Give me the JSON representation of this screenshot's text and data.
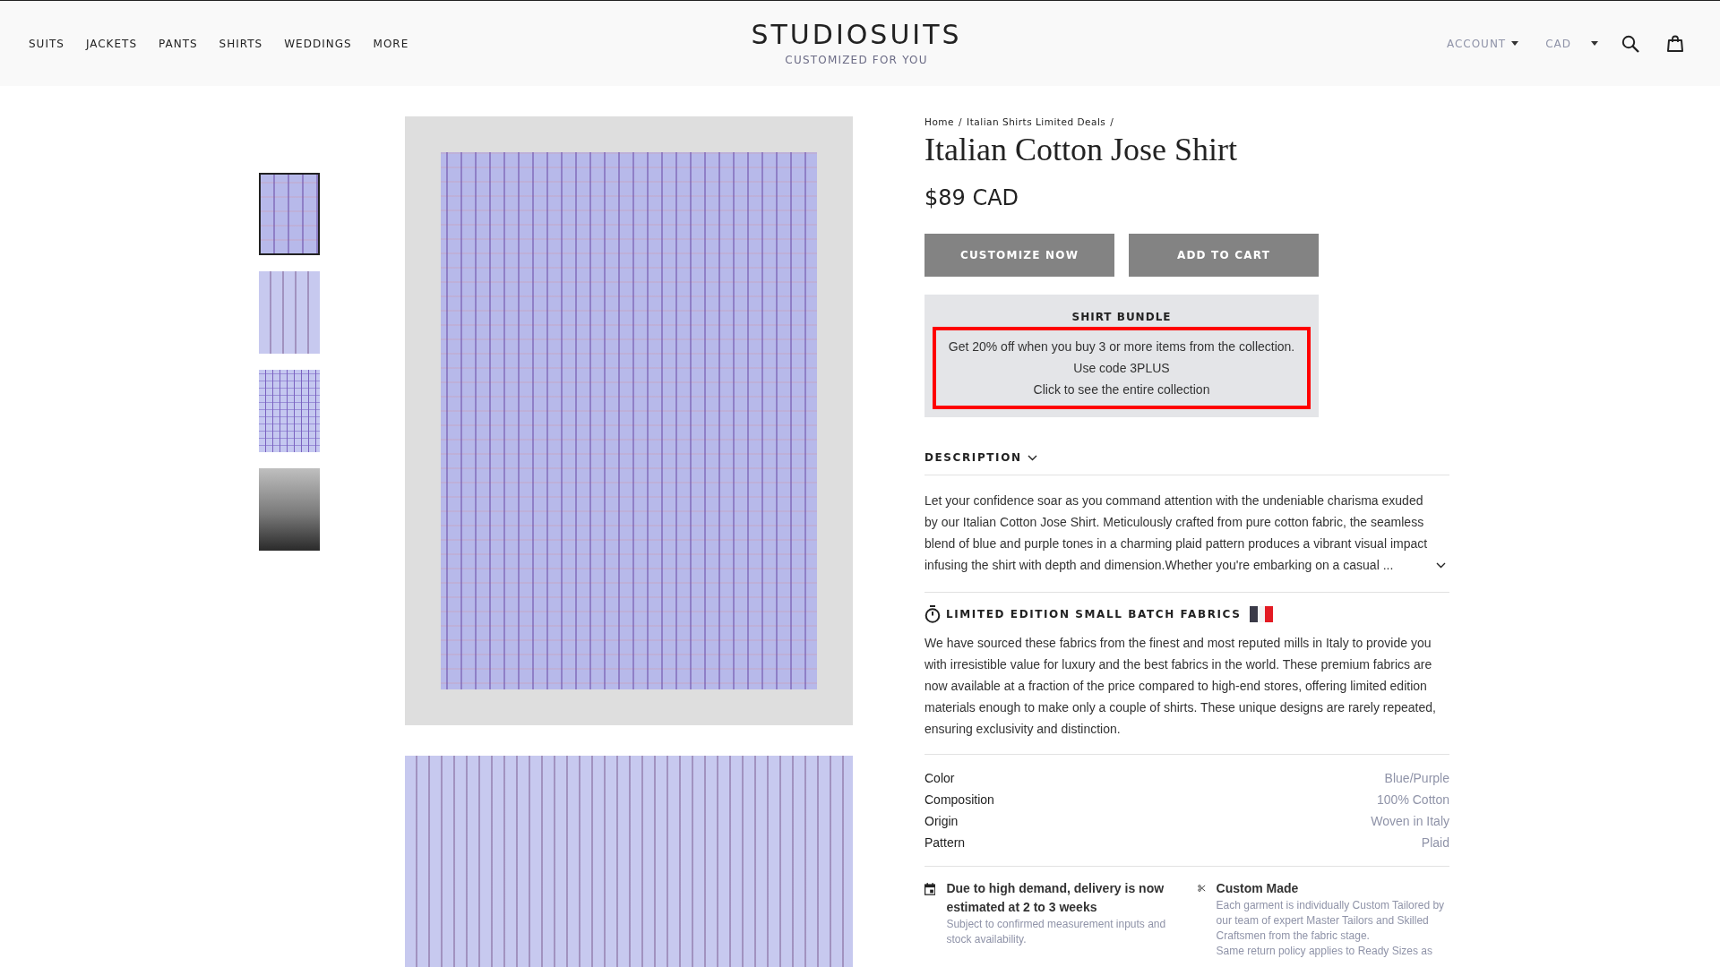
{
  "header": {
    "nav": [
      "SUITS",
      "JACKETS",
      "PANTS",
      "SHIRTS",
      "WEDDINGS",
      "MORE"
    ],
    "logo": "STUDIOSUITS",
    "tagline": "CUSTOMIZED FOR YOU",
    "account": "ACCOUNT",
    "currency": "CAD"
  },
  "gallery": {
    "thumbnails": [
      {
        "kind": "folded-shirt",
        "selected": true
      },
      {
        "kind": "shirt",
        "selected": false
      },
      {
        "kind": "fabric",
        "selected": false
      },
      {
        "kind": "city",
        "selected": false
      }
    ],
    "photos": [
      {
        "kind": "folded-shirt"
      },
      {
        "kind": "shirt"
      }
    ]
  },
  "product": {
    "breadcrumb": [
      "Home",
      "Italian Shirts Limited Deals"
    ],
    "breadcrumb_separator": "/",
    "title": "Italian Cotton Jose Shirt",
    "price": "$89 CAD",
    "buttons": [
      "CUSTOMIZE NOW",
      "ADD TO CART"
    ],
    "bundle": {
      "title": "SHIRT BUNDLE",
      "lines": [
        "Get 20% off when you buy 3 or more items from the collection.",
        "Use code 3PLUS",
        "Click to see the entire collection"
      ]
    },
    "description": {
      "heading": "DESCRIPTION",
      "text": "Let your confidence soar as you command attention with the undeniable charisma exuded by our Italian Cotton Jose Shirt. Meticulously crafted from pure cotton fabric, the seamless blend of blue and purple tones in a charming plaid pattern produces a vibrant visual impact infusing the shirt with depth and dimension.Whether you're embarking on a casual ..."
    },
    "fabrics": {
      "heading": "LIMITED EDITION SMALL BATCH FABRICS",
      "text": "We have sourced these fabrics from the finest and most reputed mills in Italy to provide you with irresistible value for luxury and the best fabrics in the world. These premium fabrics are now available at a fraction of the price compared to high-end stores, offering limited edition materials enough to make only a couple of shirts. These unique designs are rarely repeated, ensuring exclusivity and distinction."
    },
    "specs": [
      {
        "label": "Color",
        "value": "Blue/Purple"
      },
      {
        "label": "Composition",
        "value": "100% Cotton"
      },
      {
        "label": "Origin",
        "value": "Woven in Italy"
      },
      {
        "label": "Pattern",
        "value": "Plaid"
      }
    ],
    "features": [
      {
        "kind": "calendar",
        "title": "Due to high demand, delivery is now estimated at 2 to 3 weeks",
        "lines": [
          "Subject to confirmed measurement inputs and stock availability."
        ]
      },
      {
        "kind": "scissors",
        "title": "Custom Made",
        "lines": [
          "Each garment is individually Custom Tailored by our team of expert Master Tailors and Skilled Craftsmen from the fabric stage.",
          "Same return policy applies to Ready Sizes as"
        ]
      }
    ]
  }
}
